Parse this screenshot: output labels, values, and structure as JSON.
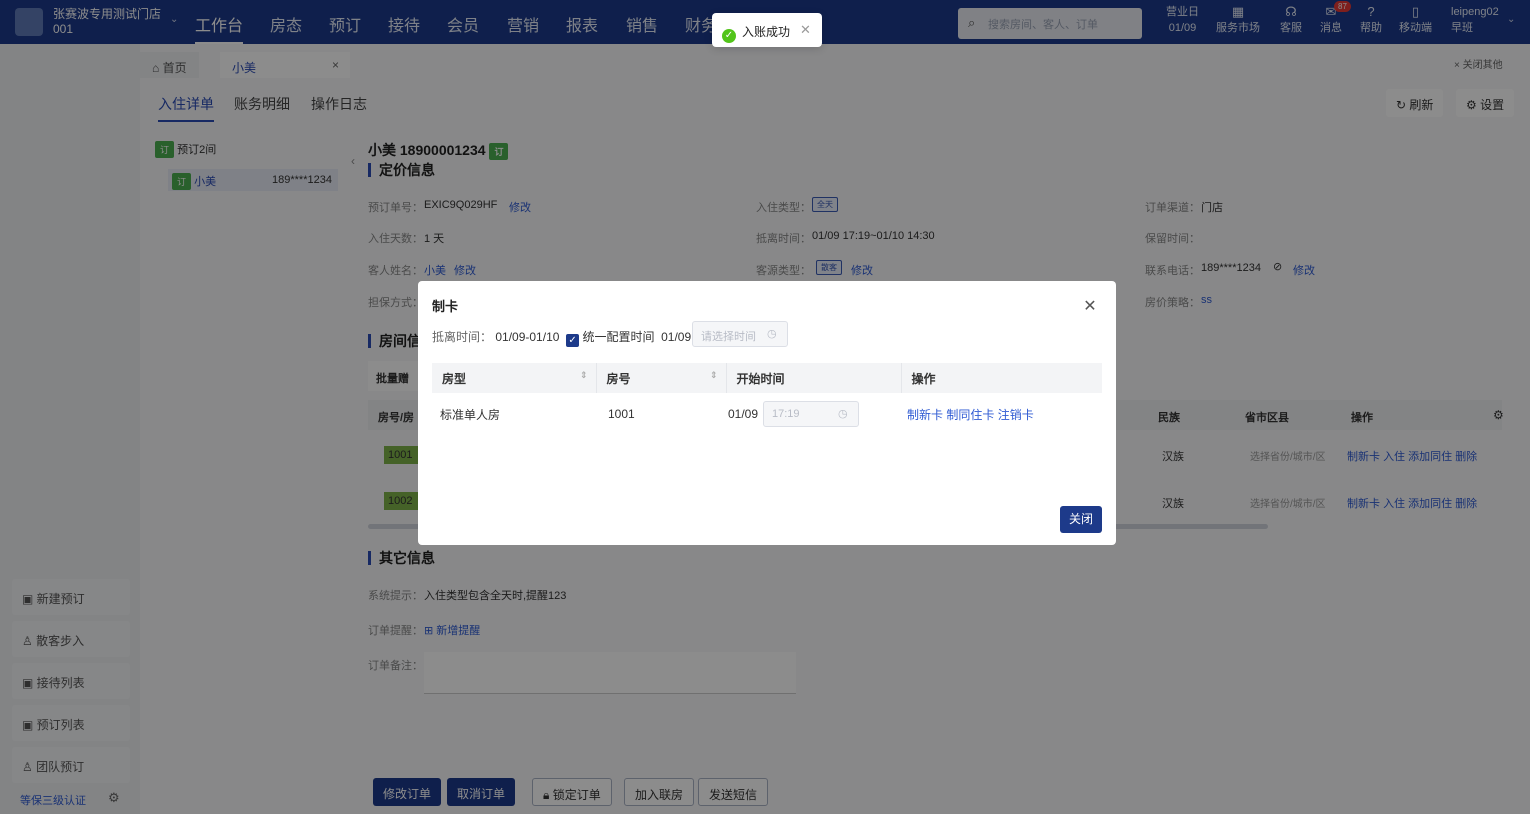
{
  "topnav": {
    "store_name": "张赛波专用测试门店",
    "store_code": "001",
    "items": [
      "工作台",
      "房态",
      "预订",
      "接待",
      "会员",
      "营销",
      "报表",
      "销售",
      "财务"
    ],
    "search_placeholder": "搜索房间、客人、订单",
    "business_day_label": "营业日",
    "business_day": "01/09",
    "tools": [
      "服务市场",
      "客服",
      "消息",
      "帮助",
      "移动端"
    ],
    "message_count": "87",
    "user": "leipeng02",
    "shift": "早班"
  },
  "toast": {
    "message": "入账成功"
  },
  "page_tabs": {
    "home": "首页",
    "current": "小美",
    "close_others": "关闭其他"
  },
  "sub_tabs": [
    "入住详单",
    "账务明细",
    "操作日志"
  ],
  "actions": {
    "refresh": "刷新",
    "settings": "设置"
  },
  "order_tree": {
    "group_badge": "订",
    "group_label": "预订2间",
    "item_badge": "订",
    "item_name": "小美",
    "item_phone": "189****1234"
  },
  "sidebar": {
    "buttons": [
      "新建预订",
      "散客步入",
      "接待列表",
      "预订列表",
      "团队预订"
    ],
    "cert": "等保三级认证"
  },
  "guest_header": {
    "name_phone": "小美 18900001234",
    "badge": "订"
  },
  "sections": {
    "pricing": "定价信息",
    "rooms": "房间信",
    "other": "其它信息"
  },
  "pricing": {
    "order_no_label": "预订单号：",
    "order_no": "EXIC9Q029HF",
    "edit": "修改",
    "checkin_type_label": "入住类型：",
    "checkin_type": "全天",
    "channel_label": "订单渠道：",
    "channel": "门店",
    "days_label": "入住天数：",
    "days": "1 天",
    "stay_time_label": "抵离时间：",
    "stay_time": "01/09 17:19~01/10 14:30",
    "hold_time_label": "保留时间：",
    "guest_name_label": "客人姓名：",
    "guest_name": "小美",
    "source_label": "客源类型：",
    "source": "散客",
    "contact_label": "联系电话：",
    "contact": "189****1234",
    "guarantee_label": "担保方式：",
    "price_policy_label": "房价策略：",
    "price_policy": "ss"
  },
  "room_table": {
    "batch_label": "批量赠",
    "col_room": "房号/房",
    "rooms": [
      "1001",
      "1002"
    ],
    "col_ethnic": "民族",
    "col_region": "省市区县",
    "col_ops": "操作",
    "ethnic_value": "汉族",
    "region_placeholder": "选择省份/城市/区",
    "row_ops": [
      "制新卡",
      "入住",
      "添加同住",
      "删除"
    ]
  },
  "other_info": {
    "sys_hint_label": "系统提示：",
    "sys_hint": "入住类型包含全天时,提醒123",
    "reminder_label": "订单提醒：",
    "reminder_add": "新增提醒",
    "remark_label": "订单备注："
  },
  "bottom_buttons": [
    "修改订单",
    "取消订单",
    "锁定订单",
    "加入联房",
    "发送短信"
  ],
  "modal": {
    "title": "制卡",
    "stay_label": "抵离时间：",
    "stay_value": "01/09-01/10",
    "unify_label": "统一配置时间",
    "unify_date": "01/09",
    "time_placeholder": "请选择时间",
    "columns": [
      "房型",
      "房号",
      "开始时间",
      "操作"
    ],
    "rows": [
      {
        "room_type": "标准单人房",
        "room_no": "1001",
        "start_date": "01/09",
        "start_time": "17:19",
        "ops": [
          "制新卡",
          "制同住卡",
          "注销卡"
        ]
      }
    ],
    "close": "关闭"
  }
}
